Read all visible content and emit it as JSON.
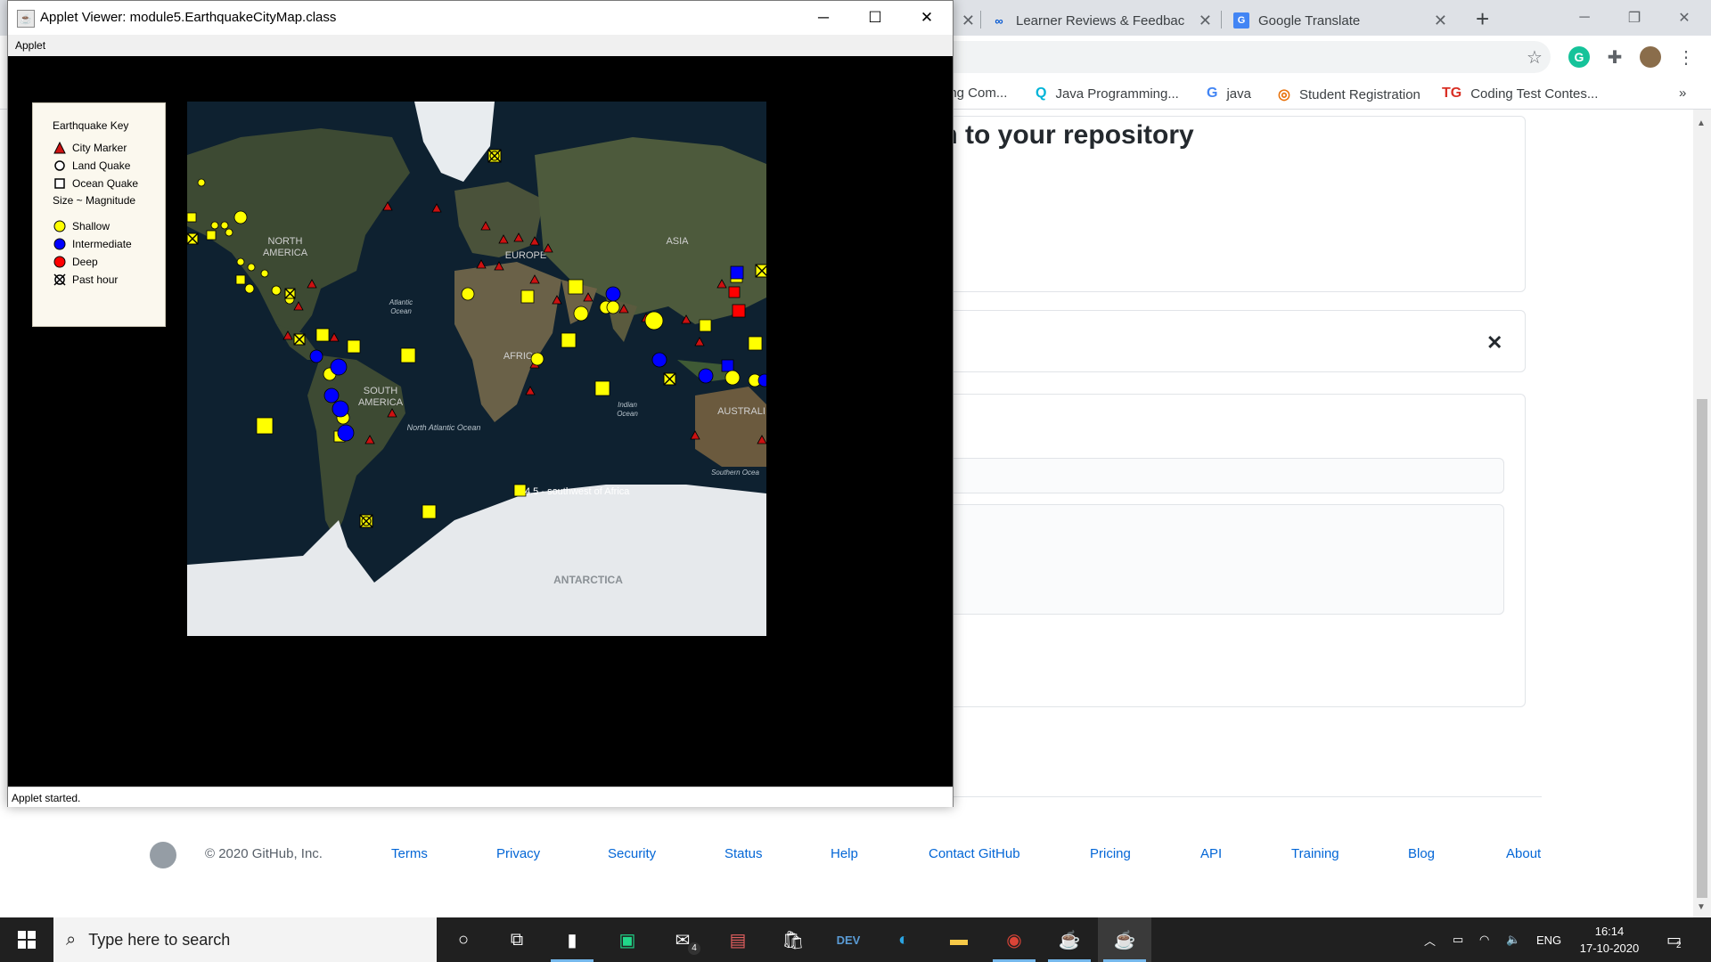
{
  "browser": {
    "tabs": [
      {
        "label": "Learner Reviews & Feedback",
        "icon": "coursera-icon"
      },
      {
        "label": "Google Translate",
        "icon": "google-translate-icon"
      }
    ],
    "new_tab": "+",
    "bookmarks": [
      {
        "label": "ing Com...",
        "icon": ""
      },
      {
        "label": "Java Programming...",
        "icon": "Q"
      },
      {
        "label": "java",
        "icon": "G"
      },
      {
        "label": "Student Registration",
        "icon": ""
      },
      {
        "label": "Coding Test Contes...",
        "icon": "TG"
      }
    ],
    "bookmarks_more": "»"
  },
  "github": {
    "heading_fragment": "m to your repository",
    "footer": {
      "copyright": "© 2020 GitHub, Inc.",
      "links": [
        "Terms",
        "Privacy",
        "Security",
        "Status",
        "Help",
        "Contact GitHub",
        "Pricing",
        "API",
        "Training",
        "Blog",
        "About"
      ]
    }
  },
  "applet": {
    "title": "Applet Viewer: module5.EarthquakeCityMap.class",
    "menu": "Applet",
    "status": "Applet started.",
    "key": {
      "title": "Earthquake Key",
      "city_marker": "City Marker",
      "land_quake": "Land Quake",
      "ocean_quake": "Ocean Quake",
      "size_label": "Size ~ Magnitude",
      "shallow": "Shallow",
      "intermediate": "Intermediate",
      "deep": "Deep",
      "past_hour": "Past hour"
    },
    "map": {
      "labels": {
        "north_america": "NORTH\nAMERICA",
        "south_america": "SOUTH\nAMERICA",
        "europe": "EUROPE",
        "asia": "ASIA",
        "africa": "AFRICA",
        "australia": "AUSTRALI",
        "antarctica": "ANTARCTICA",
        "atlantic": "Atlantic\nOcean",
        "north_atlantic": "North Atlantic Ocean",
        "indian": "Indian\nOcean",
        "southern": "Southern Ocea"
      },
      "tooltip": "4.5 - southwest of Africa"
    },
    "colors": {
      "shallow": "#ffff00",
      "intermediate": "#0000ff",
      "deep": "#ff0000",
      "city": "#cc1111"
    }
  },
  "taskbar": {
    "search_placeholder": "Type here to search",
    "language": "ENG",
    "time": "16:14",
    "date": "17-10-2020",
    "mail_badge": "4",
    "notification_count": "2"
  }
}
